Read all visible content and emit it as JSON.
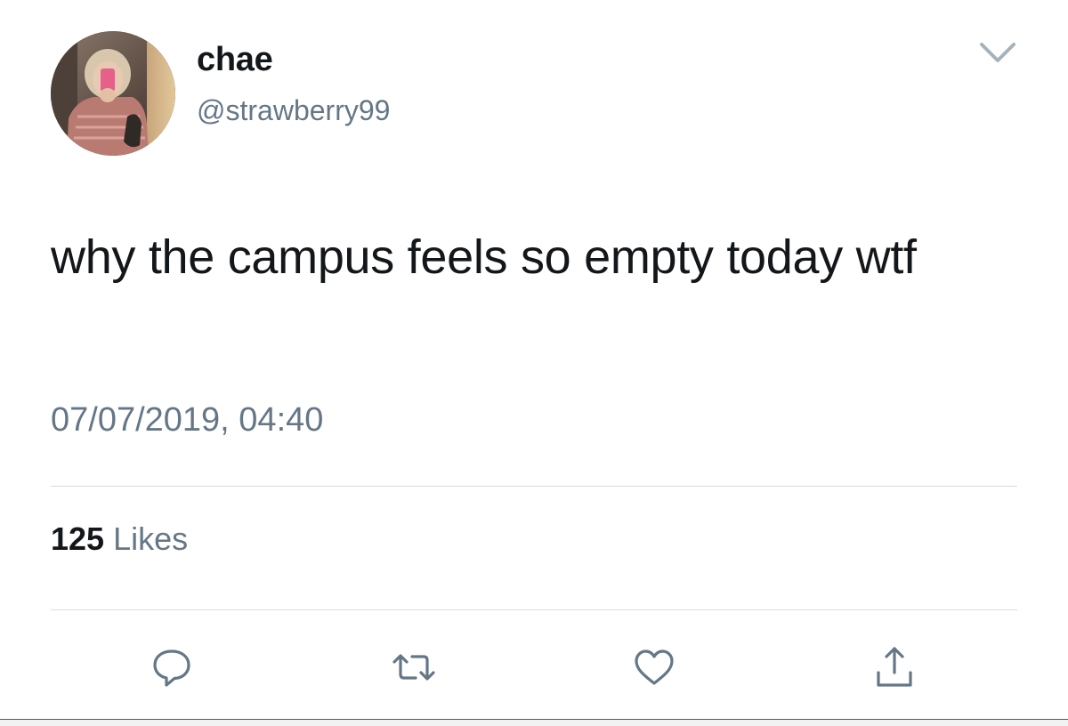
{
  "user": {
    "display_name": "chae",
    "handle": "@strawberry99",
    "avatar": "profile-photo"
  },
  "tweet": {
    "text": "why the campus feels so empty today wtf",
    "timestamp": "07/07/2019, 04:40"
  },
  "stats": {
    "likes_count": "125",
    "likes_label": "Likes"
  },
  "actions": {
    "reply_icon": "reply-icon",
    "retweet_icon": "retweet-icon",
    "like_icon": "heart-icon",
    "share_icon": "share-icon",
    "menu_icon": "chevron-down-icon"
  },
  "colors": {
    "text_primary": "#14171a",
    "text_secondary": "#657786",
    "divider": "#d7dce0",
    "icon": "#657786"
  }
}
